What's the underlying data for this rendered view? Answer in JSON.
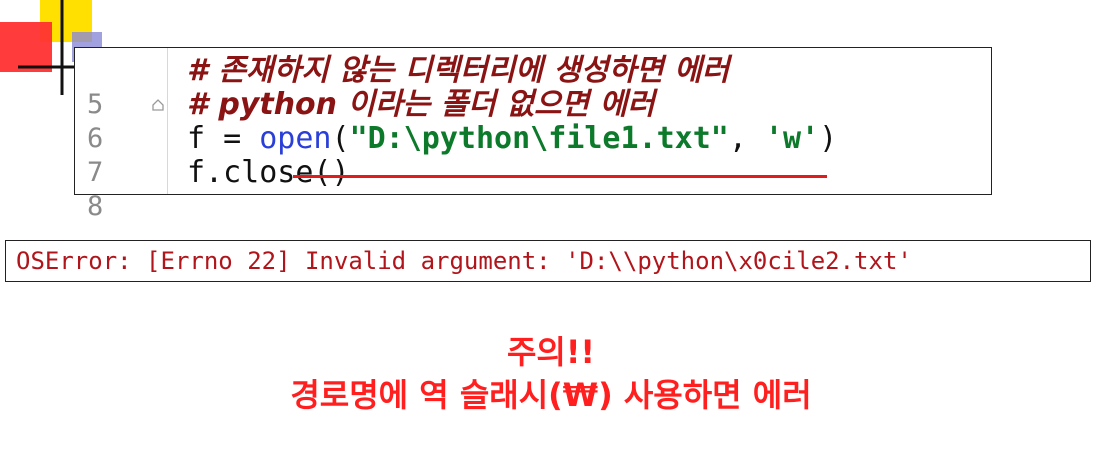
{
  "code_editor": {
    "lines": [
      {
        "number": "5",
        "text": "# 존재하지 않는 디렉터리에 생성하면 에러"
      },
      {
        "number": "6",
        "text_keyword": "# python",
        "text_rest": " 이라는 폴더 없으면 에러"
      },
      {
        "number": "7",
        "tokens": {
          "var": "f",
          "op": " = ",
          "func": "open",
          "paren_open": "(",
          "path_string": "\"D:\\python\\file1.txt\"",
          "comma": ", ",
          "mode_string": "'w'",
          "paren_close": ")"
        }
      },
      {
        "number": "8",
        "text": "f.close()"
      }
    ],
    "colors": {
      "comment": "#8a1313",
      "builtin": "#2a3fd8",
      "string": "#0c7a2a",
      "error_underline": "#e01d1d"
    }
  },
  "error_output": {
    "text": "OSError: [Errno 22] Invalid argument: 'D:\\\\python\\x0cile2.txt'"
  },
  "warning": {
    "line1": "주의!!",
    "line2": "경로명에 역 슬래시(₩) 사용하면 에러",
    "color": "#ff1f1f"
  },
  "decoration": {
    "colors": [
      "#ffe000",
      "#ff3030",
      "#8a8ad8"
    ]
  }
}
